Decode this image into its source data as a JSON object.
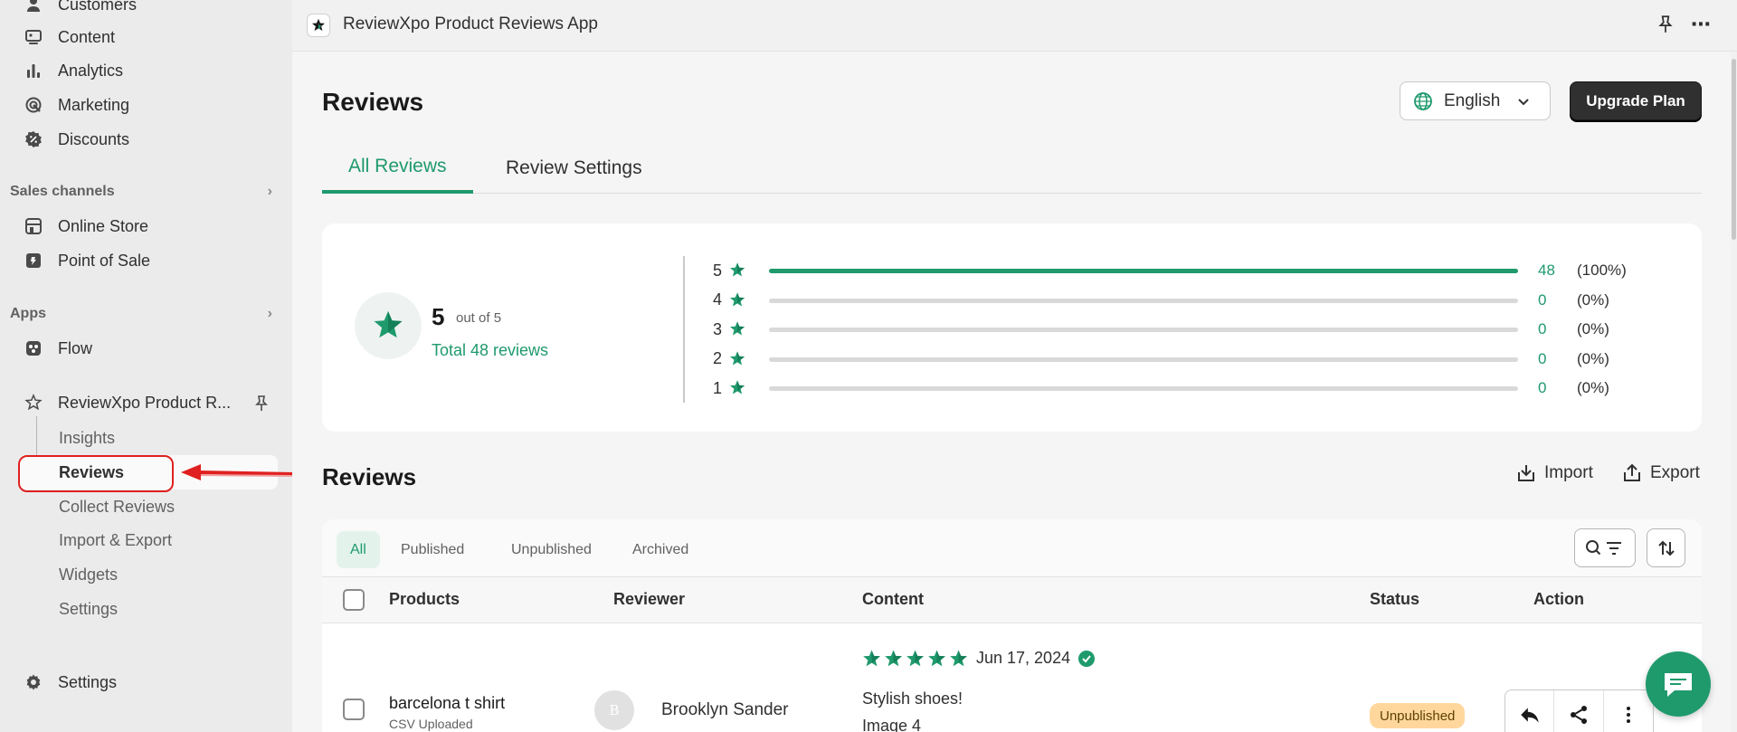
{
  "sidebar": {
    "nav": [
      {
        "label": "Customers",
        "icon": "person-icon"
      },
      {
        "label": "Content",
        "icon": "content-icon"
      },
      {
        "label": "Analytics",
        "icon": "bar-chart-icon"
      },
      {
        "label": "Marketing",
        "icon": "target-icon"
      },
      {
        "label": "Discounts",
        "icon": "discount-icon"
      }
    ],
    "sales_channels": {
      "title": "Sales channels",
      "items": [
        {
          "label": "Online Store",
          "icon": "store-icon"
        },
        {
          "label": "Point of Sale",
          "icon": "pos-icon"
        }
      ]
    },
    "apps": {
      "title": "Apps",
      "items": [
        {
          "label": "Flow",
          "icon": "flow-icon"
        }
      ]
    },
    "app": {
      "name": "ReviewXpo Product R...",
      "sub_items": [
        "Insights",
        "Reviews",
        "Collect Reviews",
        "Import & Export",
        "Widgets",
        "Settings"
      ]
    },
    "settings_label": "Settings"
  },
  "topbar": {
    "title": "ReviewXpo Product Reviews App"
  },
  "page": {
    "title": "Reviews",
    "language": "English",
    "upgrade_label": "Upgrade Plan",
    "tabs": [
      "All Reviews",
      "Review Settings"
    ]
  },
  "summary": {
    "average": "5",
    "out_of": "out of 5",
    "total": "Total 48 reviews",
    "distribution": [
      {
        "level": "5",
        "count": "48",
        "percent": "(100%)",
        "fraction": 1.0
      },
      {
        "level": "4",
        "count": "0",
        "percent": "(0%)",
        "fraction": 0
      },
      {
        "level": "3",
        "count": "0",
        "percent": "(0%)",
        "fraction": 0
      },
      {
        "level": "2",
        "count": "0",
        "percent": "(0%)",
        "fraction": 0
      },
      {
        "level": "1",
        "count": "0",
        "percent": "(0%)",
        "fraction": 0
      }
    ]
  },
  "reviews": {
    "title": "Reviews",
    "import_label": "Import",
    "export_label": "Export",
    "filters": [
      "All",
      "Published",
      "Unpublished",
      "Archived"
    ],
    "columns": [
      "Products",
      "Reviewer",
      "Content",
      "Status",
      "Action"
    ],
    "rows": [
      {
        "product": "barcelona t shirt",
        "product_sub": "CSV Uploaded",
        "avatar_initial": "B",
        "reviewer": "Brooklyn Sander",
        "rating": 5,
        "date": "Jun 17, 2024",
        "title": "Stylish shoes!",
        "body": "Image 4",
        "status": "Unpublished"
      }
    ]
  },
  "colors": {
    "accent": "#1f9a6d",
    "annotation": "#e02020"
  }
}
